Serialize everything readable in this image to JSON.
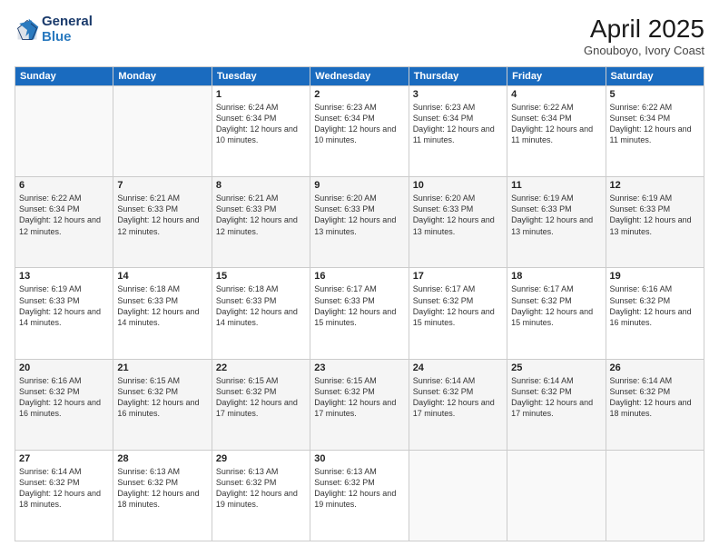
{
  "header": {
    "logo_line1": "General",
    "logo_line2": "Blue",
    "month_year": "April 2025",
    "location": "Gnouboyo, Ivory Coast"
  },
  "weekdays": [
    "Sunday",
    "Monday",
    "Tuesday",
    "Wednesday",
    "Thursday",
    "Friday",
    "Saturday"
  ],
  "rows": [
    [
      {
        "day": "",
        "sunrise": "",
        "sunset": "",
        "daylight": "",
        "empty": true
      },
      {
        "day": "",
        "sunrise": "",
        "sunset": "",
        "daylight": "",
        "empty": true
      },
      {
        "day": "1",
        "sunrise": "Sunrise: 6:24 AM",
        "sunset": "Sunset: 6:34 PM",
        "daylight": "Daylight: 12 hours and 10 minutes."
      },
      {
        "day": "2",
        "sunrise": "Sunrise: 6:23 AM",
        "sunset": "Sunset: 6:34 PM",
        "daylight": "Daylight: 12 hours and 10 minutes."
      },
      {
        "day": "3",
        "sunrise": "Sunrise: 6:23 AM",
        "sunset": "Sunset: 6:34 PM",
        "daylight": "Daylight: 12 hours and 11 minutes."
      },
      {
        "day": "4",
        "sunrise": "Sunrise: 6:22 AM",
        "sunset": "Sunset: 6:34 PM",
        "daylight": "Daylight: 12 hours and 11 minutes."
      },
      {
        "day": "5",
        "sunrise": "Sunrise: 6:22 AM",
        "sunset": "Sunset: 6:34 PM",
        "daylight": "Daylight: 12 hours and 11 minutes."
      }
    ],
    [
      {
        "day": "6",
        "sunrise": "Sunrise: 6:22 AM",
        "sunset": "Sunset: 6:34 PM",
        "daylight": "Daylight: 12 hours and 12 minutes."
      },
      {
        "day": "7",
        "sunrise": "Sunrise: 6:21 AM",
        "sunset": "Sunset: 6:33 PM",
        "daylight": "Daylight: 12 hours and 12 minutes."
      },
      {
        "day": "8",
        "sunrise": "Sunrise: 6:21 AM",
        "sunset": "Sunset: 6:33 PM",
        "daylight": "Daylight: 12 hours and 12 minutes."
      },
      {
        "day": "9",
        "sunrise": "Sunrise: 6:20 AM",
        "sunset": "Sunset: 6:33 PM",
        "daylight": "Daylight: 12 hours and 13 minutes."
      },
      {
        "day": "10",
        "sunrise": "Sunrise: 6:20 AM",
        "sunset": "Sunset: 6:33 PM",
        "daylight": "Daylight: 12 hours and 13 minutes."
      },
      {
        "day": "11",
        "sunrise": "Sunrise: 6:19 AM",
        "sunset": "Sunset: 6:33 PM",
        "daylight": "Daylight: 12 hours and 13 minutes."
      },
      {
        "day": "12",
        "sunrise": "Sunrise: 6:19 AM",
        "sunset": "Sunset: 6:33 PM",
        "daylight": "Daylight: 12 hours and 13 minutes."
      }
    ],
    [
      {
        "day": "13",
        "sunrise": "Sunrise: 6:19 AM",
        "sunset": "Sunset: 6:33 PM",
        "daylight": "Daylight: 12 hours and 14 minutes."
      },
      {
        "day": "14",
        "sunrise": "Sunrise: 6:18 AM",
        "sunset": "Sunset: 6:33 PM",
        "daylight": "Daylight: 12 hours and 14 minutes."
      },
      {
        "day": "15",
        "sunrise": "Sunrise: 6:18 AM",
        "sunset": "Sunset: 6:33 PM",
        "daylight": "Daylight: 12 hours and 14 minutes."
      },
      {
        "day": "16",
        "sunrise": "Sunrise: 6:17 AM",
        "sunset": "Sunset: 6:33 PM",
        "daylight": "Daylight: 12 hours and 15 minutes."
      },
      {
        "day": "17",
        "sunrise": "Sunrise: 6:17 AM",
        "sunset": "Sunset: 6:32 PM",
        "daylight": "Daylight: 12 hours and 15 minutes."
      },
      {
        "day": "18",
        "sunrise": "Sunrise: 6:17 AM",
        "sunset": "Sunset: 6:32 PM",
        "daylight": "Daylight: 12 hours and 15 minutes."
      },
      {
        "day": "19",
        "sunrise": "Sunrise: 6:16 AM",
        "sunset": "Sunset: 6:32 PM",
        "daylight": "Daylight: 12 hours and 16 minutes."
      }
    ],
    [
      {
        "day": "20",
        "sunrise": "Sunrise: 6:16 AM",
        "sunset": "Sunset: 6:32 PM",
        "daylight": "Daylight: 12 hours and 16 minutes."
      },
      {
        "day": "21",
        "sunrise": "Sunrise: 6:15 AM",
        "sunset": "Sunset: 6:32 PM",
        "daylight": "Daylight: 12 hours and 16 minutes."
      },
      {
        "day": "22",
        "sunrise": "Sunrise: 6:15 AM",
        "sunset": "Sunset: 6:32 PM",
        "daylight": "Daylight: 12 hours and 17 minutes."
      },
      {
        "day": "23",
        "sunrise": "Sunrise: 6:15 AM",
        "sunset": "Sunset: 6:32 PM",
        "daylight": "Daylight: 12 hours and 17 minutes."
      },
      {
        "day": "24",
        "sunrise": "Sunrise: 6:14 AM",
        "sunset": "Sunset: 6:32 PM",
        "daylight": "Daylight: 12 hours and 17 minutes."
      },
      {
        "day": "25",
        "sunrise": "Sunrise: 6:14 AM",
        "sunset": "Sunset: 6:32 PM",
        "daylight": "Daylight: 12 hours and 17 minutes."
      },
      {
        "day": "26",
        "sunrise": "Sunrise: 6:14 AM",
        "sunset": "Sunset: 6:32 PM",
        "daylight": "Daylight: 12 hours and 18 minutes."
      }
    ],
    [
      {
        "day": "27",
        "sunrise": "Sunrise: 6:14 AM",
        "sunset": "Sunset: 6:32 PM",
        "daylight": "Daylight: 12 hours and 18 minutes."
      },
      {
        "day": "28",
        "sunrise": "Sunrise: 6:13 AM",
        "sunset": "Sunset: 6:32 PM",
        "daylight": "Daylight: 12 hours and 18 minutes."
      },
      {
        "day": "29",
        "sunrise": "Sunrise: 6:13 AM",
        "sunset": "Sunset: 6:32 PM",
        "daylight": "Daylight: 12 hours and 19 minutes."
      },
      {
        "day": "30",
        "sunrise": "Sunrise: 6:13 AM",
        "sunset": "Sunset: 6:32 PM",
        "daylight": "Daylight: 12 hours and 19 minutes."
      },
      {
        "day": "",
        "sunrise": "",
        "sunset": "",
        "daylight": "",
        "empty": true
      },
      {
        "day": "",
        "sunrise": "",
        "sunset": "",
        "daylight": "",
        "empty": true
      },
      {
        "day": "",
        "sunrise": "",
        "sunset": "",
        "daylight": "",
        "empty": true
      }
    ]
  ]
}
